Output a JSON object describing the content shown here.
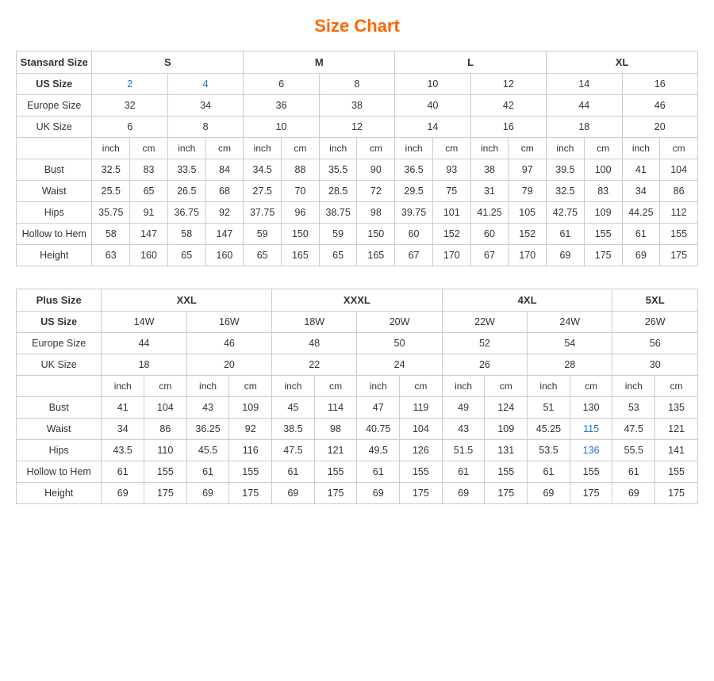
{
  "title": "Size Chart",
  "standard": {
    "label": "Stansard Size",
    "sizeGroups": [
      "S",
      "M",
      "L",
      "XL"
    ],
    "usSize": {
      "label": "US Size",
      "values": [
        "2",
        "4",
        "6",
        "8",
        "10",
        "12",
        "14",
        "16"
      ]
    },
    "europeSize": {
      "label": "Europe Size",
      "values": [
        "32",
        "34",
        "36",
        "38",
        "40",
        "42",
        "44",
        "46"
      ]
    },
    "ukSize": {
      "label": "UK Size",
      "values": [
        "6",
        "8",
        "10",
        "12",
        "14",
        "16",
        "18",
        "20"
      ]
    },
    "units": [
      "inch",
      "cm",
      "inch",
      "cm",
      "inch",
      "cm",
      "inch",
      "cm",
      "inch",
      "cm",
      "inch",
      "cm",
      "inch",
      "cm",
      "inch",
      "cm"
    ],
    "bust": {
      "label": "Bust",
      "values": [
        "32.5",
        "83",
        "33.5",
        "84",
        "34.5",
        "88",
        "35.5",
        "90",
        "36.5",
        "93",
        "38",
        "97",
        "39.5",
        "100",
        "41",
        "104"
      ]
    },
    "waist": {
      "label": "Waist",
      "values": [
        "25.5",
        "65",
        "26.5",
        "68",
        "27.5",
        "70",
        "28.5",
        "72",
        "29.5",
        "75",
        "31",
        "79",
        "32.5",
        "83",
        "34",
        "86"
      ]
    },
    "hips": {
      "label": "Hips",
      "values": [
        "35.75",
        "91",
        "36.75",
        "92",
        "37.75",
        "96",
        "38.75",
        "98",
        "39.75",
        "101",
        "41.25",
        "105",
        "42.75",
        "109",
        "44.25",
        "112"
      ]
    },
    "hollowToHem": {
      "label": "Hollow to Hem",
      "values": [
        "58",
        "147",
        "58",
        "147",
        "59",
        "150",
        "59",
        "150",
        "60",
        "152",
        "60",
        "152",
        "61",
        "155",
        "61",
        "155"
      ]
    },
    "height": {
      "label": "Height",
      "values": [
        "63",
        "160",
        "65",
        "160",
        "65",
        "165",
        "65",
        "165",
        "67",
        "170",
        "67",
        "170",
        "69",
        "175",
        "69",
        "175"
      ]
    }
  },
  "plus": {
    "label": "Plus Size",
    "sizeGroups": [
      "XXL",
      "XXXL",
      "4XL",
      "5XL"
    ],
    "usSize": {
      "label": "US Size",
      "values": [
        "14W",
        "16W",
        "18W",
        "20W",
        "22W",
        "24W",
        "26W"
      ]
    },
    "europeSize": {
      "label": "Europe Size",
      "values": [
        "44",
        "46",
        "48",
        "50",
        "52",
        "54",
        "56"
      ]
    },
    "ukSize": {
      "label": "UK Size",
      "values": [
        "18",
        "20",
        "22",
        "24",
        "26",
        "28",
        "30"
      ]
    },
    "units": [
      "inch",
      "cm",
      "inch",
      "cm",
      "inch",
      "cm",
      "inch",
      "cm",
      "inch",
      "cm",
      "inch",
      "cm",
      "inch",
      "cm"
    ],
    "bust": {
      "label": "Bust",
      "values": [
        "41",
        "104",
        "43",
        "109",
        "45",
        "114",
        "47",
        "119",
        "49",
        "124",
        "51",
        "130",
        "53",
        "135"
      ]
    },
    "waist": {
      "label": "Waist",
      "values": [
        "34",
        "86",
        "36.25",
        "92",
        "38.5",
        "98",
        "40.75",
        "104",
        "43",
        "109",
        "45.25",
        "115",
        "47.5",
        "121"
      ]
    },
    "hips": {
      "label": "Hips",
      "values": [
        "43.5",
        "110",
        "45.5",
        "116",
        "47.5",
        "121",
        "49.5",
        "126",
        "51.5",
        "131",
        "53.5",
        "136",
        "55.5",
        "141"
      ]
    },
    "hollowToHem": {
      "label": "Hollow to Hem",
      "values": [
        "61",
        "155",
        "61",
        "155",
        "61",
        "155",
        "61",
        "155",
        "61",
        "155",
        "61",
        "155",
        "61",
        "155"
      ]
    },
    "height": {
      "label": "Height",
      "values": [
        "69",
        "175",
        "69",
        "175",
        "69",
        "175",
        "69",
        "175",
        "69",
        "175",
        "69",
        "175",
        "69",
        "175"
      ]
    }
  }
}
